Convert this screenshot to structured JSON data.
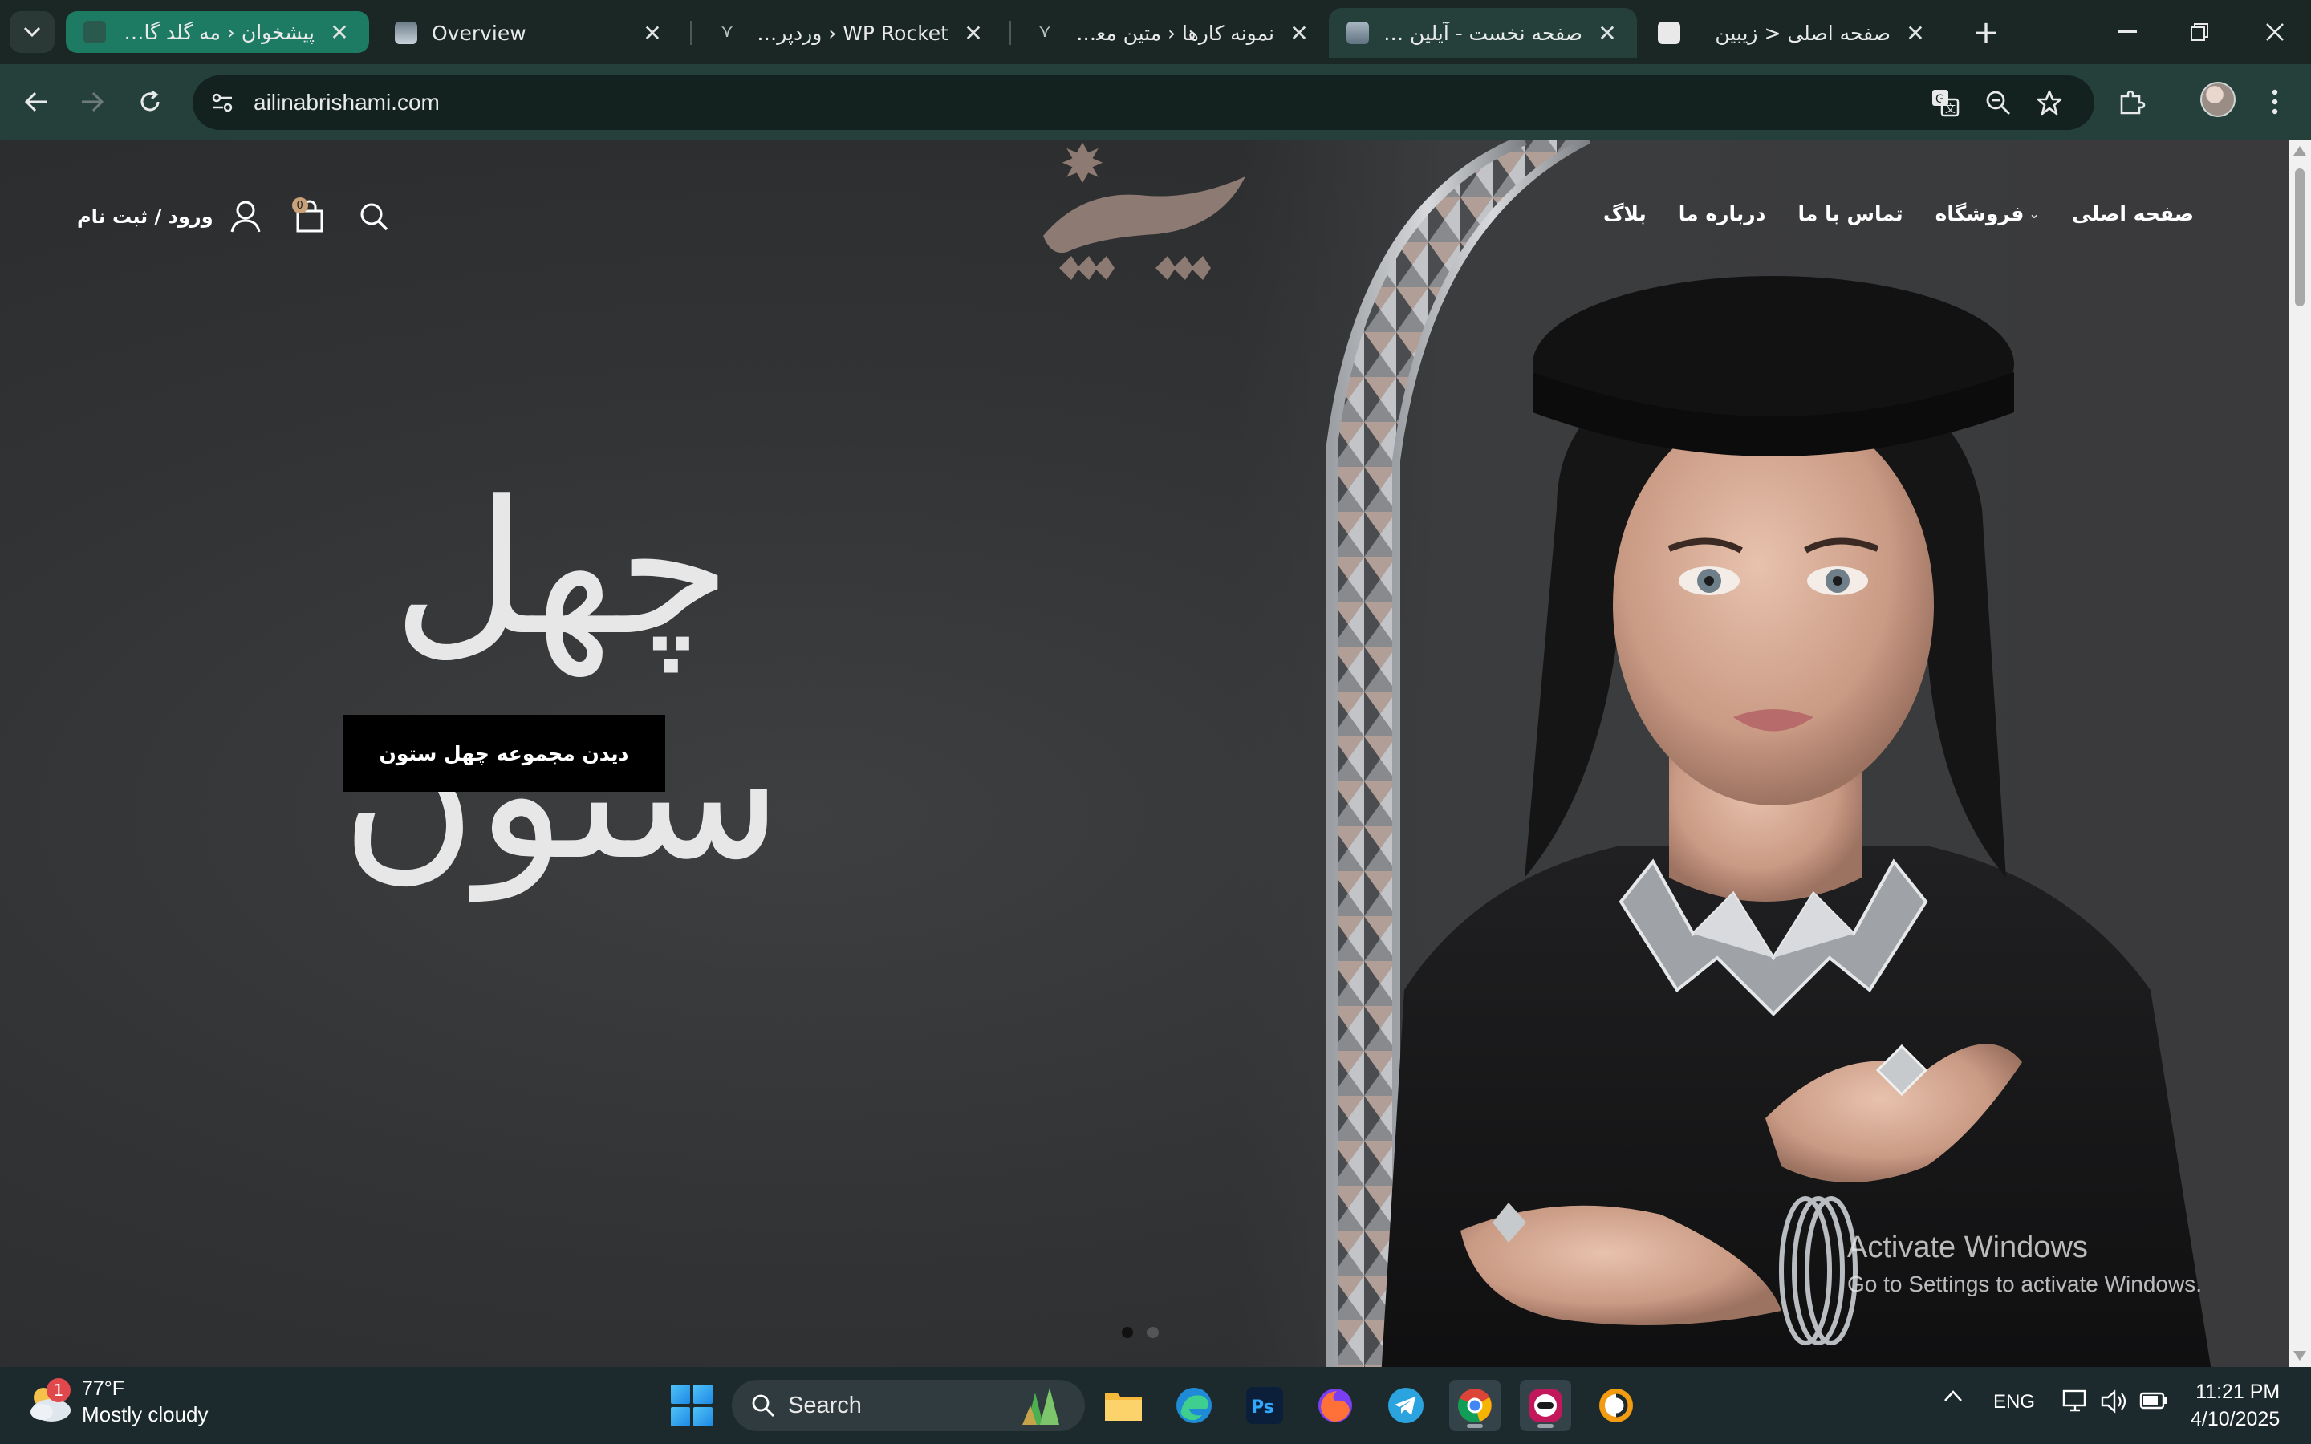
{
  "browser": {
    "tabs": [
      {
        "label": "پیشخوان ‹ مه گلد گالری —",
        "group": true
      },
      {
        "label": "Overview"
      },
      {
        "label": "WP Rocket ‹ وردپرس —"
      },
      {
        "label": "نمونه کارها ‹ متین معظمی"
      },
      {
        "label": "صفحه نخست - آیلین ابریشمی",
        "active": true
      },
      {
        "label": "صفحه اصلی < زیبین"
      }
    ],
    "address": "ailinabrishami.com"
  },
  "site": {
    "nav": {
      "home": "صفحه اصلی",
      "shop": "فروشگاه",
      "contact": "تماس با ما",
      "about": "درباره ما",
      "blog": "بلاگ"
    },
    "login": "ورود / ثبت نام",
    "cart_count": "0",
    "hero": {
      "title": "چهل ستون",
      "button": "دیدن مجموعه چهل ستون"
    }
  },
  "watermark": {
    "line1": "Activate Windows",
    "line2": "Go to Settings to activate Windows."
  },
  "taskbar": {
    "weather_temp": "77°F",
    "weather_cond": "Mostly cloudy",
    "weather_badge": "1",
    "search": "Search",
    "lang": "ENG",
    "time": "11:21 PM",
    "date": "4/10/2025"
  }
}
